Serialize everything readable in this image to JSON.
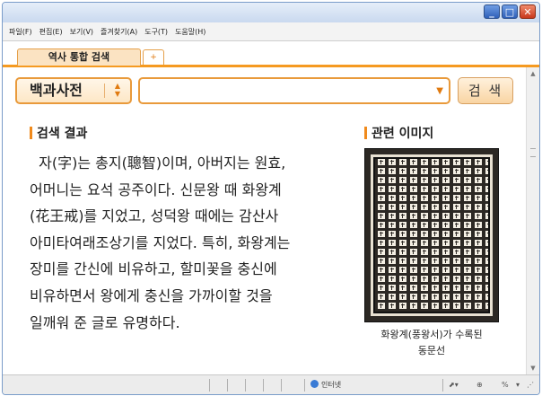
{
  "window": {
    "buttons": [
      "_",
      "□",
      "✕"
    ]
  },
  "menu": [
    "파일(F)",
    "편집(E)",
    "보기(V)",
    "즐겨찾기(A)",
    "도구(T)",
    "도움말(H)"
  ],
  "tab": {
    "label": "역사 통합 검색",
    "new_tab": "+"
  },
  "search": {
    "category": "백과사전",
    "query": "",
    "button": "검 색"
  },
  "result": {
    "heading": "검색 결과",
    "lines": [
      "  자(字)는 총지(聰智)이며, 아버지는 원효,",
      "어머니는 요석 공주이다. 신문왕 때 화왕계",
      "(花王戒)를 지었고, 성덕왕 때에는 감산사",
      "아미타여래조상기를 지었다. 특히, 화왕계는",
      "장미를 간신에 비유하고, 할미꽃을 충신에",
      "비유하면서 왕에게 충신을 가까이할 것을",
      "일깨워 준 글로 유명하다."
    ]
  },
  "related": {
    "heading": "관련 이미지",
    "caption": "화왕계(풍왕서)가 수록된\n동문선"
  },
  "status": {
    "zone": "인터넷",
    "zoom": "%"
  }
}
